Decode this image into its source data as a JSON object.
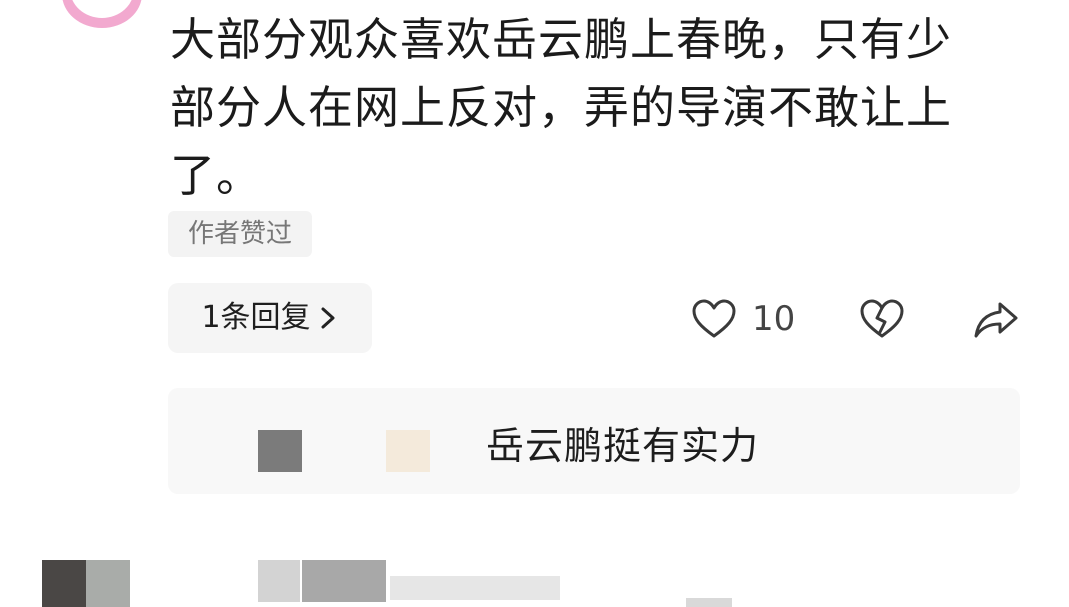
{
  "comment": {
    "text": "大部分观众喜欢岳云鹏上春晚，只有少部分人在网上反对，弄的导演不敢让上了。",
    "author_liked_badge": "作者赞过"
  },
  "actions": {
    "replies_label": "1条回复",
    "like_count": "10",
    "icons": [
      "heart-icon",
      "broken-heart-icon",
      "share-icon",
      "chevron-right-icon"
    ]
  },
  "reply_preview": {
    "text": "岳云鹏挺有实力"
  },
  "colors": {
    "avatar_ring": "#f2a9cf",
    "badge_bg": "#f3f3f3",
    "reply_bg": "#f8f8f8"
  }
}
